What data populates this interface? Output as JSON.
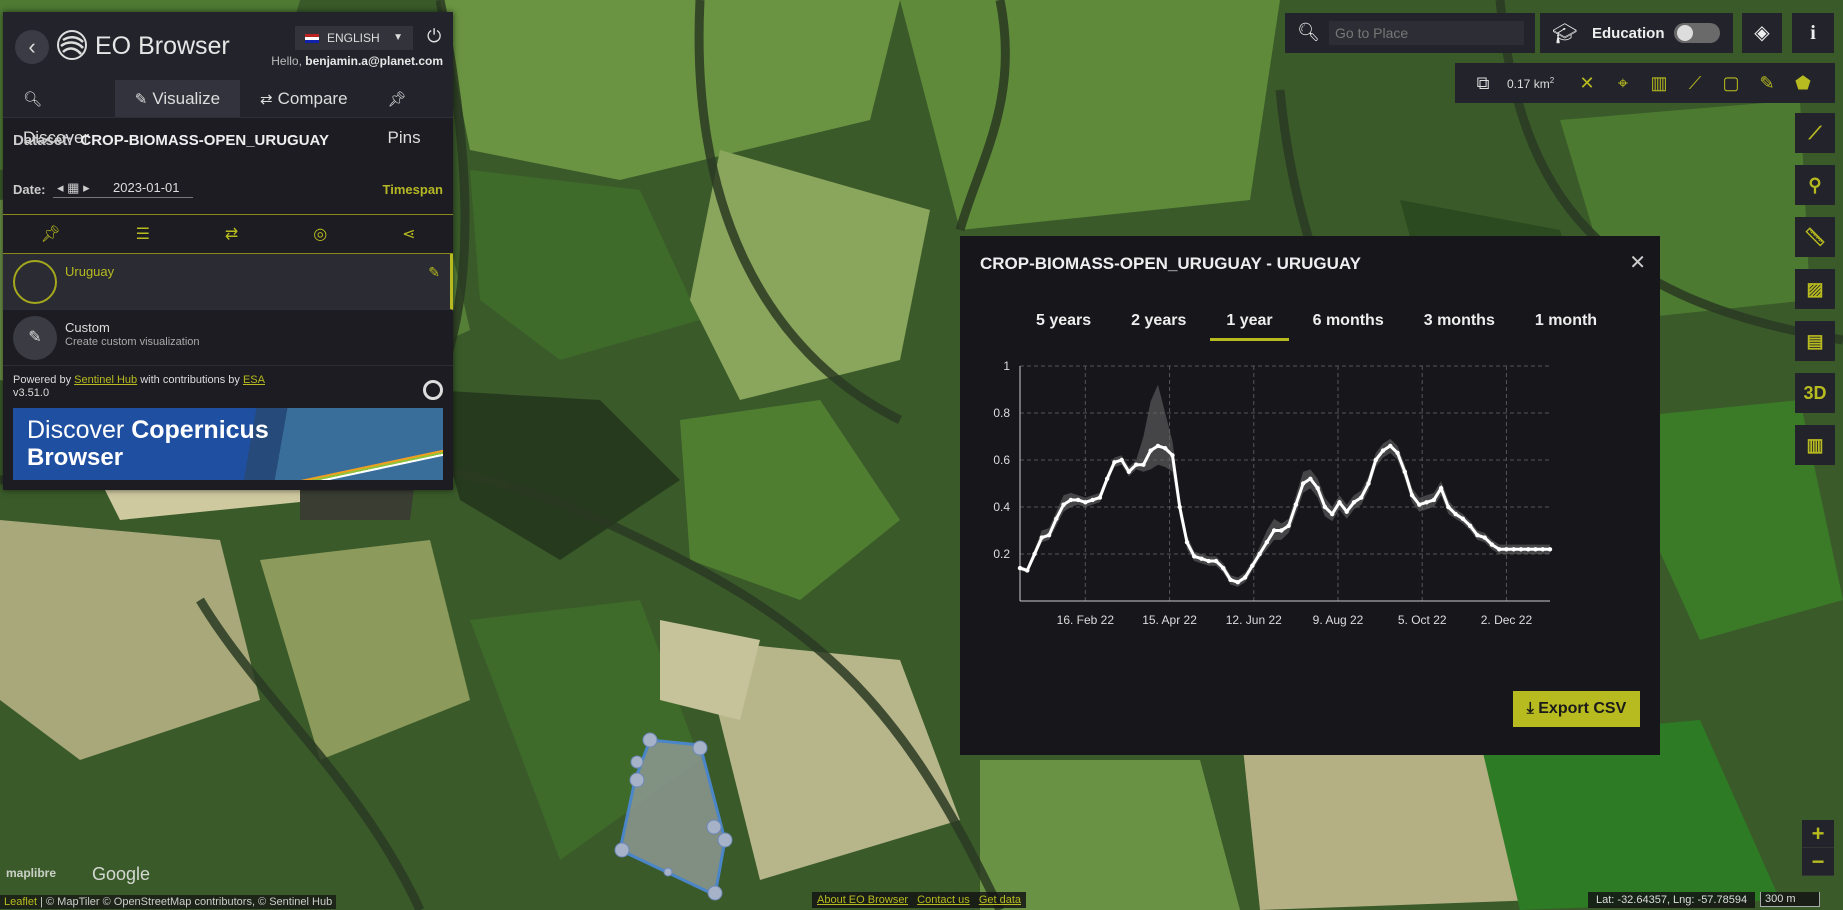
{
  "app": {
    "title": "EO Browser",
    "language": "ENGLISH",
    "hello_prefix": "Hello,",
    "user": "benjamin.a@planet.com"
  },
  "tabs": [
    {
      "label": "Discover",
      "icon": "search-icon"
    },
    {
      "label": "Visualize",
      "icon": "brush-icon",
      "active": true
    },
    {
      "label": "Compare",
      "icon": "swap-icon"
    },
    {
      "label": "Pins",
      "icon": "pin-icon"
    }
  ],
  "dataset": {
    "label": "Dataset:",
    "value": "CROP-BIOMASS-OPEN_URUGUAY"
  },
  "date": {
    "label": "Date:",
    "value": "2023-01-01",
    "timespan": "Timespan"
  },
  "layer_toolbar": [
    "pin-icon",
    "sliders-icon",
    "swap-icon",
    "eye-slash-icon",
    "share-icon"
  ],
  "visualizations": [
    {
      "name": "Uruguay",
      "desc": "",
      "selected": true
    },
    {
      "name": "Custom",
      "desc": "Create custom visualization",
      "selected": false
    }
  ],
  "powered": {
    "prefix": "Powered by",
    "sentinel": "Sentinel Hub",
    "middle": "with contributions by",
    "esa": "ESA",
    "version": "v3.51.0"
  },
  "banner": {
    "line1_a": "Discover",
    "line1_b": "Copernicus",
    "line2": "Browser"
  },
  "search": {
    "placeholder": "Go to Place"
  },
  "education": {
    "label": "Education",
    "enabled": false
  },
  "tools": {
    "area": "0.17 km",
    "area_sup": "2"
  },
  "side_tools": [
    "line-icon",
    "location-pin-icon",
    "ruler-icon",
    "image-download-icon",
    "film-icon",
    "3D",
    "chart-icon"
  ],
  "modal": {
    "title": "CROP-BIOMASS-OPEN_URUGUAY - URUGUAY",
    "periods": [
      "5 years",
      "2 years",
      "1 year",
      "6 months",
      "3 months",
      "1 month"
    ],
    "active_period": "1 year",
    "export_label": "Export CSV"
  },
  "chart_data": {
    "type": "line",
    "title": "",
    "xlabel": "",
    "ylabel": "",
    "x_ticks": [
      "16. Feb 22",
      "15. Apr 22",
      "12. Jun 22",
      "9. Aug 22",
      "5. Oct 22",
      "2. Dec 22"
    ],
    "y_ticks": [
      "0.2",
      "0.4",
      "0.6",
      "0.8",
      "1"
    ],
    "ylim": [
      0.0,
      1.0
    ],
    "xlim_days": [
      0,
      365
    ],
    "x_day_offsets_note_free": true,
    "series": [
      {
        "x_days": [
          0,
          5,
          10,
          15,
          20,
          25,
          30,
          35,
          40,
          45,
          50,
          55,
          60,
          65,
          70,
          75,
          80,
          85,
          90,
          95,
          100,
          105,
          110,
          115,
          120,
          125,
          130,
          135,
          140,
          145,
          150,
          155,
          160,
          165,
          170,
          175,
          180,
          185,
          190,
          195,
          200,
          205,
          210,
          215,
          220,
          225,
          230,
          235,
          240,
          245,
          250,
          255,
          260,
          265,
          270,
          275,
          280,
          285,
          290,
          295,
          300,
          305,
          310,
          315,
          320,
          325,
          330,
          335,
          340,
          345,
          350,
          355,
          360,
          365
        ],
        "values": [
          0.14,
          0.13,
          0.2,
          0.27,
          0.28,
          0.35,
          0.41,
          0.43,
          0.43,
          0.42,
          0.43,
          0.44,
          0.52,
          0.59,
          0.6,
          0.55,
          0.58,
          0.58,
          0.64,
          0.66,
          0.65,
          0.62,
          0.4,
          0.25,
          0.19,
          0.18,
          0.17,
          0.17,
          0.14,
          0.09,
          0.08,
          0.1,
          0.15,
          0.2,
          0.25,
          0.3,
          0.3,
          0.32,
          0.41,
          0.5,
          0.52,
          0.48,
          0.4,
          0.37,
          0.42,
          0.38,
          0.42,
          0.44,
          0.5,
          0.6,
          0.64,
          0.66,
          0.63,
          0.55,
          0.45,
          0.41,
          0.42,
          0.43,
          0.48,
          0.4,
          0.37,
          0.35,
          0.32,
          0.28,
          0.27,
          0.24,
          0.22,
          0.22,
          0.22,
          0.22,
          0.22,
          0.22,
          0.22,
          0.22
        ],
        "upper": [
          0.15,
          0.14,
          0.22,
          0.3,
          0.31,
          0.38,
          0.45,
          0.46,
          0.45,
          0.44,
          0.45,
          0.46,
          0.54,
          0.61,
          0.62,
          0.57,
          0.6,
          0.7,
          0.85,
          0.92,
          0.8,
          0.68,
          0.44,
          0.28,
          0.21,
          0.2,
          0.19,
          0.19,
          0.16,
          0.11,
          0.1,
          0.12,
          0.17,
          0.23,
          0.3,
          0.35,
          0.33,
          0.35,
          0.45,
          0.55,
          0.56,
          0.52,
          0.44,
          0.4,
          0.45,
          0.41,
          0.45,
          0.47,
          0.53,
          0.63,
          0.67,
          0.69,
          0.66,
          0.58,
          0.48,
          0.44,
          0.45,
          0.46,
          0.51,
          0.43,
          0.39,
          0.37,
          0.34,
          0.3,
          0.29,
          0.26,
          0.24,
          0.24,
          0.24,
          0.24,
          0.24,
          0.24,
          0.24,
          0.24
        ],
        "lower": [
          0.13,
          0.12,
          0.18,
          0.25,
          0.26,
          0.32,
          0.38,
          0.4,
          0.41,
          0.4,
          0.41,
          0.42,
          0.5,
          0.57,
          0.58,
          0.53,
          0.56,
          0.55,
          0.56,
          0.58,
          0.57,
          0.55,
          0.36,
          0.22,
          0.17,
          0.16,
          0.15,
          0.15,
          0.12,
          0.07,
          0.06,
          0.08,
          0.13,
          0.18,
          0.22,
          0.26,
          0.26,
          0.29,
          0.37,
          0.46,
          0.48,
          0.44,
          0.36,
          0.34,
          0.39,
          0.35,
          0.39,
          0.41,
          0.47,
          0.57,
          0.61,
          0.63,
          0.6,
          0.52,
          0.42,
          0.38,
          0.39,
          0.4,
          0.45,
          0.37,
          0.35,
          0.33,
          0.3,
          0.26,
          0.25,
          0.22,
          0.2,
          0.2,
          0.2,
          0.2,
          0.2,
          0.2,
          0.2,
          0.2
        ]
      }
    ],
    "grid": true
  },
  "footer": {
    "attribution_leaflet": "Leaflet",
    "attribution_rest": "| © MapTiler © OpenStreetMap contributors, © Sentinel Hub",
    "links": [
      "About EO Browser",
      "Contact us",
      "Get data"
    ],
    "coords": "Lat: -32.64357, Lng: -57.78594",
    "scale": "300 m",
    "google": "Google",
    "maplibre": "maplibre"
  }
}
